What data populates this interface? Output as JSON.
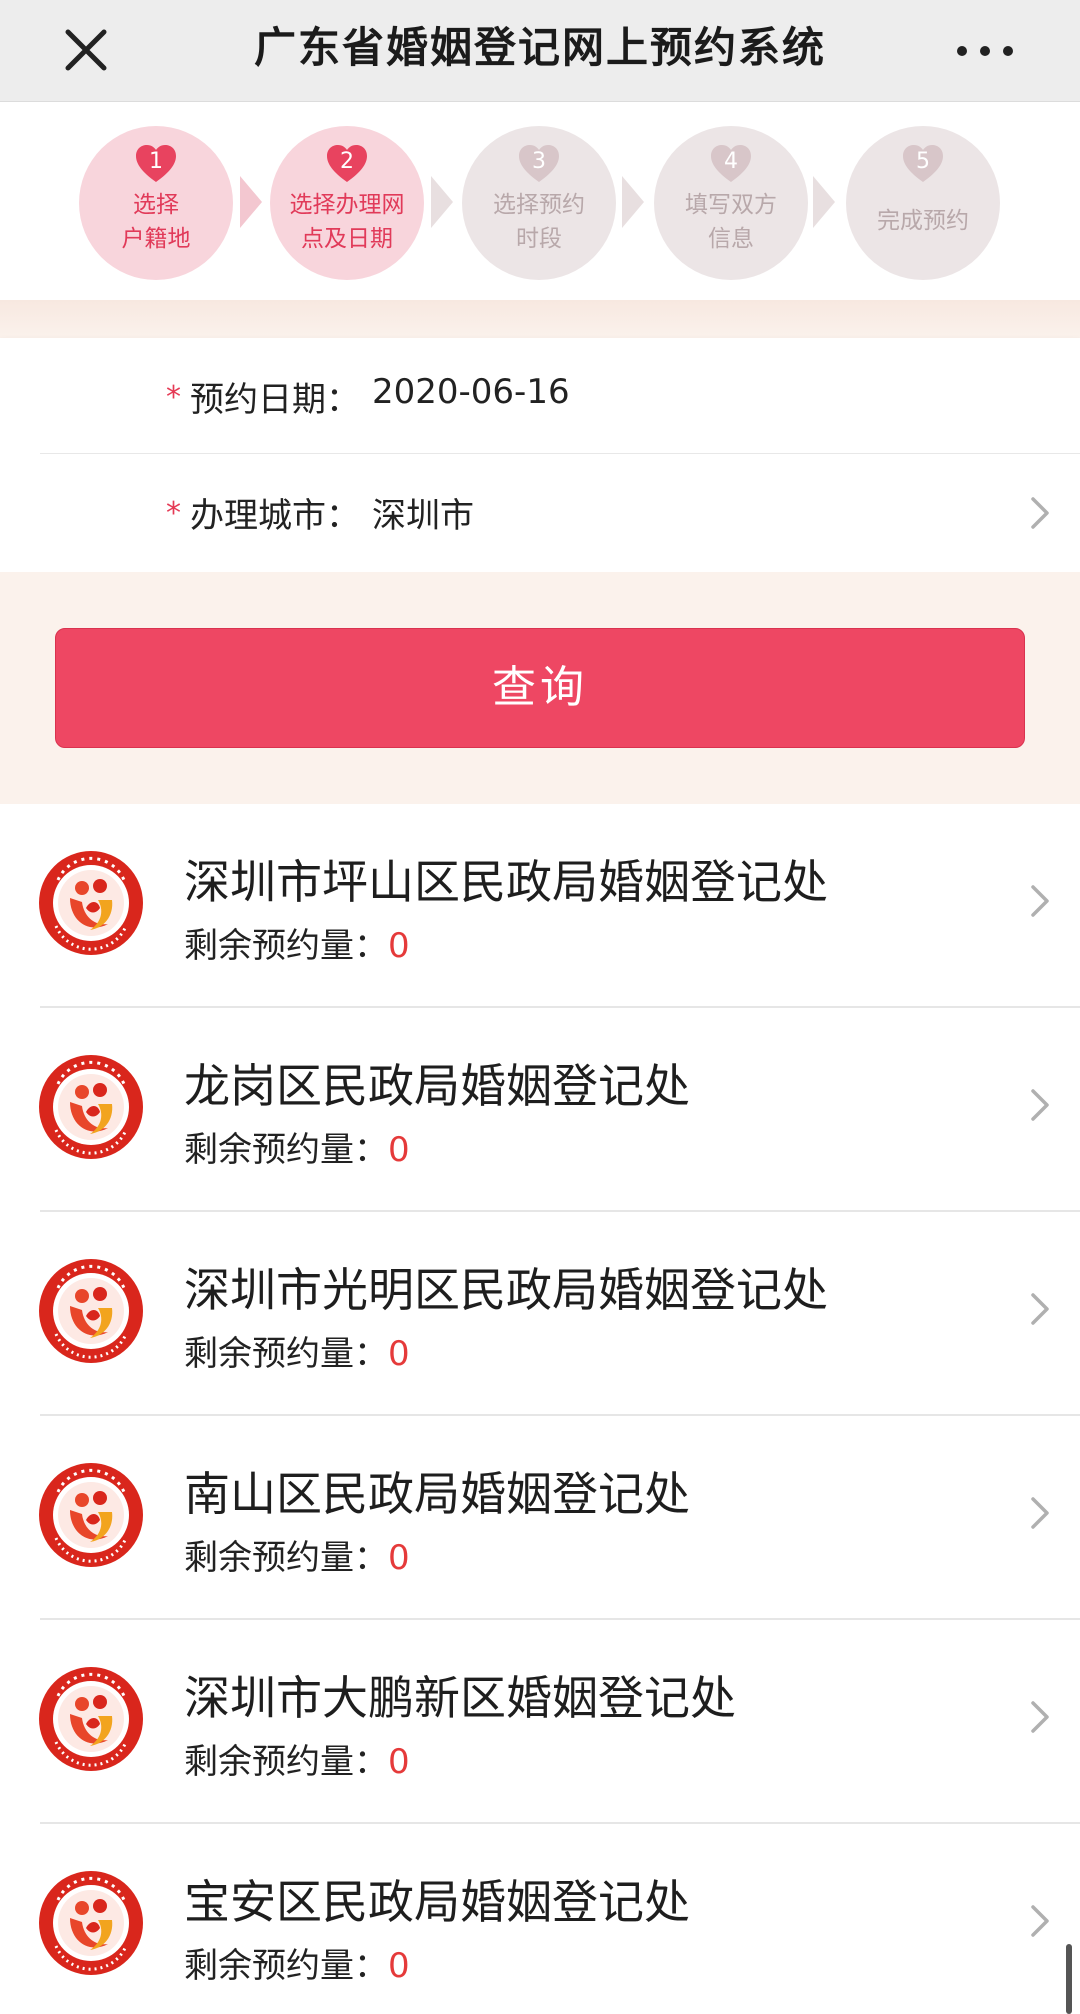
{
  "header": {
    "title": "广东省婚姻登记网上预约系统"
  },
  "steps": [
    {
      "number": "1",
      "label_line1": "选择",
      "label_line2": "户籍地",
      "state": "active"
    },
    {
      "number": "2",
      "label_line1": "选择办理网",
      "label_line2": "点及日期",
      "state": "active"
    },
    {
      "number": "3",
      "label_line1": "选择预约",
      "label_line2": "时段",
      "state": "inactive"
    },
    {
      "number": "4",
      "label_line1": "填写双方",
      "label_line2": "信息",
      "state": "inactive"
    },
    {
      "number": "5",
      "label_line1": "完成预约",
      "label_line2": "",
      "state": "inactive"
    }
  ],
  "form": {
    "required_mark": "*",
    "date_label": "预约日期：",
    "date_value": "2020-06-16",
    "city_label": "办理城市：",
    "city_value": "深圳市"
  },
  "query": {
    "button_label": "查询"
  },
  "offices": {
    "quota_label": "剩余预约量：",
    "items": [
      {
        "name": "深圳市坪山区民政局婚姻登记处",
        "remaining": "0"
      },
      {
        "name": "龙岗区民政局婚姻登记处",
        "remaining": "0"
      },
      {
        "name": "深圳市光明区民政局婚姻登记处",
        "remaining": "0"
      },
      {
        "name": "南山区民政局婚姻登记处",
        "remaining": "0"
      },
      {
        "name": "深圳市大鹏新区婚姻登记处",
        "remaining": "0"
      },
      {
        "name": "宝安区民政局婚姻登记处",
        "remaining": "0"
      }
    ]
  },
  "colors": {
    "accent": "#ee4763",
    "active_step_bg": "#f8d5dc",
    "inactive_step_bg": "#ece5e6",
    "count_red": "#e53a3a"
  },
  "icons": {
    "close": "close-icon",
    "more": "more-icon",
    "heart": "heart-icon",
    "chevron": "chevron-right-icon",
    "logo": "marriage-registration-logo"
  }
}
